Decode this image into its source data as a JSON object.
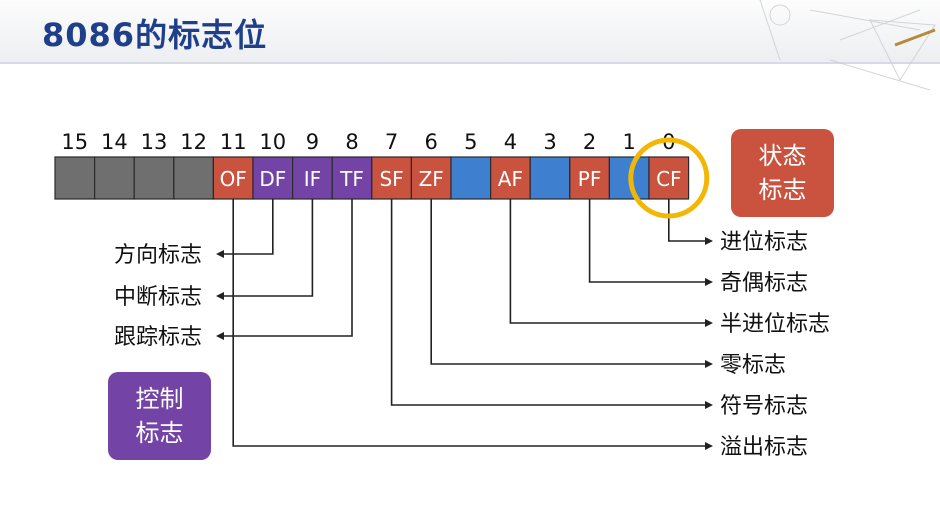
{
  "title": "8086的标志位",
  "colors": {
    "title": "#1f3f8a",
    "empty_bit": "#6f6f6f",
    "status_flag": "#c9533f",
    "control_flag": "#7443a6",
    "reserved_bit": "#3f7fcf",
    "highlight_ring": "#f2b705",
    "line": "#222222"
  },
  "register": {
    "bit_numbers": [
      "15",
      "14",
      "13",
      "12",
      "11",
      "10",
      "9",
      "8",
      "7",
      "6",
      "5",
      "4",
      "3",
      "2",
      "1",
      "0"
    ],
    "bits": [
      {
        "label": "",
        "kind": "empty"
      },
      {
        "label": "",
        "kind": "empty"
      },
      {
        "label": "",
        "kind": "empty"
      },
      {
        "label": "",
        "kind": "empty"
      },
      {
        "label": "OF",
        "kind": "status"
      },
      {
        "label": "DF",
        "kind": "control"
      },
      {
        "label": "IF",
        "kind": "control"
      },
      {
        "label": "TF",
        "kind": "control"
      },
      {
        "label": "SF",
        "kind": "status"
      },
      {
        "label": "ZF",
        "kind": "status"
      },
      {
        "label": "",
        "kind": "reserved"
      },
      {
        "label": "AF",
        "kind": "status"
      },
      {
        "label": "",
        "kind": "reserved"
      },
      {
        "label": "PF",
        "kind": "status"
      },
      {
        "label": "",
        "kind": "reserved"
      },
      {
        "label": "CF",
        "kind": "status"
      }
    ],
    "highlighted_flag": "CF"
  },
  "left_labels": [
    {
      "text": "方向标志",
      "flag": "DF"
    },
    {
      "text": "中断标志",
      "flag": "IF"
    },
    {
      "text": "跟踪标志",
      "flag": "TF"
    }
  ],
  "right_labels": [
    {
      "text": "进位标志",
      "flag": "CF"
    },
    {
      "text": "奇偶标志",
      "flag": "PF"
    },
    {
      "text": "半进位标志",
      "flag": "AF"
    },
    {
      "text": "零标志",
      "flag": "ZF"
    },
    {
      "text": "符号标志",
      "flag": "SF"
    },
    {
      "text": "溢出标志",
      "flag": "OF"
    }
  ],
  "badges": {
    "status": {
      "line1": "状态",
      "line2": "标志"
    },
    "control": {
      "line1": "控制",
      "line2": "标志"
    }
  }
}
